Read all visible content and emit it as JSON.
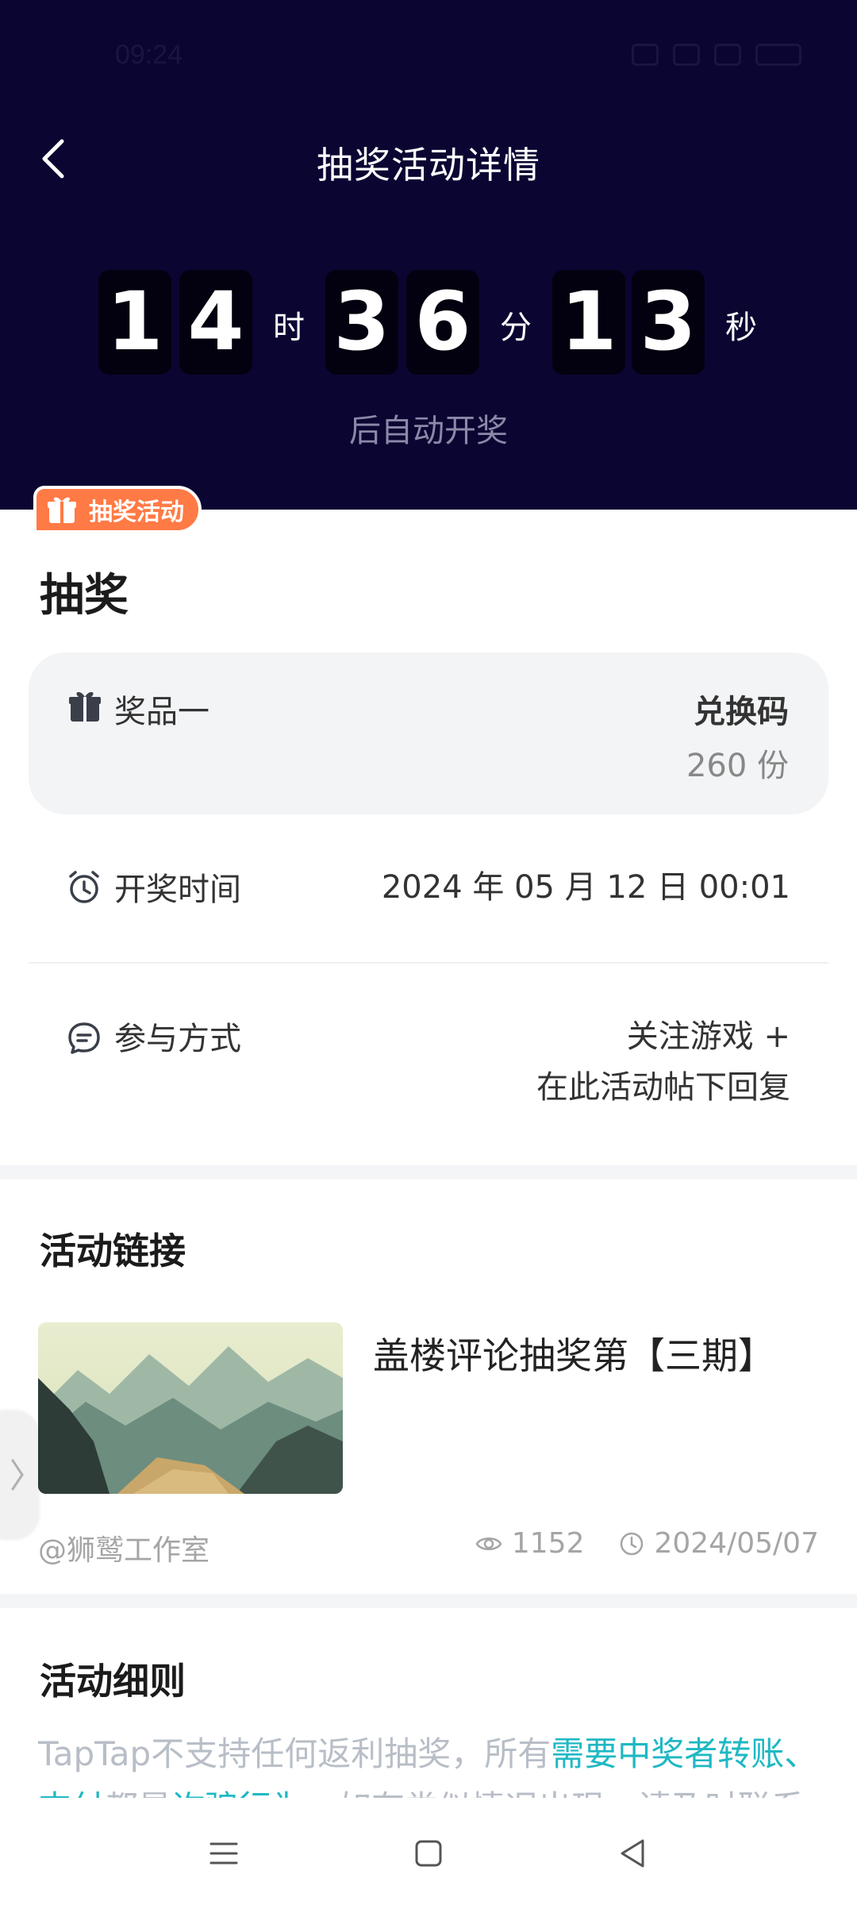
{
  "status_bar": {
    "time": "09:24"
  },
  "header": {
    "title": "抽奖活动详情",
    "back_icon": "chevron-left-icon"
  },
  "countdown": {
    "hours": [
      "1",
      "4"
    ],
    "minutes": [
      "3",
      "6"
    ],
    "seconds": [
      "1",
      "3"
    ],
    "hour_unit": "时",
    "minute_unit": "分",
    "second_unit": "秒",
    "caption": "后自动开奖"
  },
  "badge": {
    "label": "抽奖活动",
    "icon": "gift-icon"
  },
  "lottery": {
    "title": "抽奖",
    "prize": {
      "name": "奖品一",
      "type": "兑换码",
      "count": "260 份"
    },
    "draw_time": {
      "label": "开奖时间",
      "value": "2024 年 05 月 12 日 00:01"
    },
    "participation": {
      "label": "参与方式",
      "value_line1": "关注游戏 +",
      "value_line2": "在此活动帖下回复"
    }
  },
  "activity_link": {
    "section_title": "活动链接",
    "title": "盖楼评论抽奖第【三期】",
    "author": "@狮鹫工作室",
    "views": "1152",
    "date": "2024/05/07"
  },
  "rules": {
    "section_title": "活动细则",
    "text_part1": "TapTap不支持任何返利抽奖，所有",
    "text_highlight1": "需要中奖者转账、支付",
    "text_part2": "都是",
    "text_highlight2": "诈骗行为",
    "text_part3": "，如有类似情况出现，请及时联系"
  },
  "colors": {
    "header_bg": "#0b0532",
    "badge": "#ff7a45",
    "highlight": "#1fb8c3"
  }
}
